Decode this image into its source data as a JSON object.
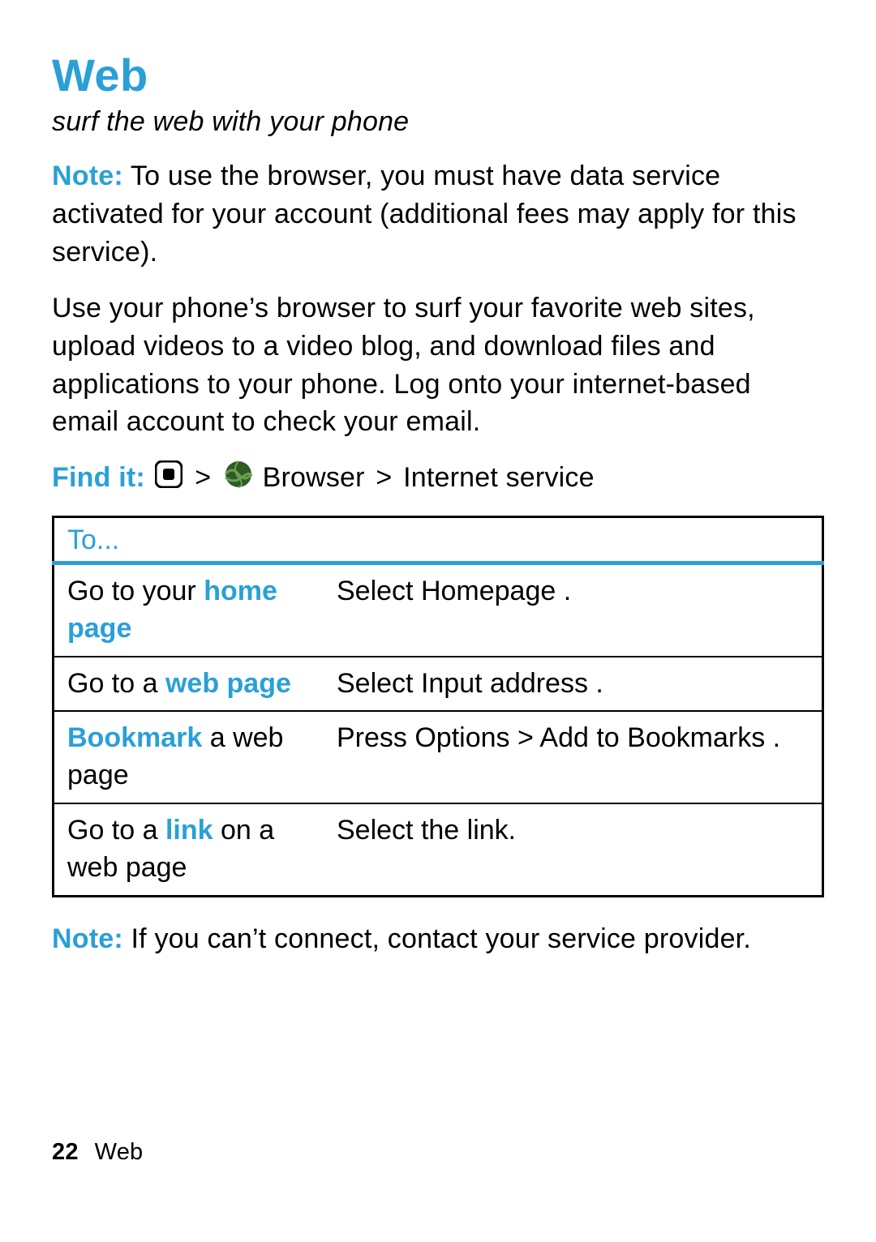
{
  "title": "Web",
  "subtitle": "surf the web with your phone",
  "note1": {
    "label": "Note:",
    "text": " To use the browser, you must have data service activated for your account (additional fees may apply for this service)."
  },
  "para1": "Use your phone’s browser to surf your favorite web sites, upload videos to a video blog, and download files and applications to your phone. Log onto your internet-based email account to check your email.",
  "find_it": {
    "label": "Find it:",
    "sep1": ">",
    "browser": "Browser",
    "sep2": ">",
    "service": "Internet service"
  },
  "table": {
    "header": "To...",
    "rows": [
      {
        "left_pre": "Go to your ",
        "left_accent": "home page",
        "left_post": "",
        "right": "Select Homepage ."
      },
      {
        "left_pre": "Go to a ",
        "left_accent": "web page",
        "left_post": "",
        "right": "Select Input address  ."
      },
      {
        "left_pre": "",
        "left_accent": "Bookmark",
        "left_post": " a web page",
        "right": "Press Options > Add to Bookmarks  ."
      },
      {
        "left_pre": "Go to a ",
        "left_accent": "link",
        "left_post": " on a web page",
        "right": "Select the link."
      }
    ]
  },
  "note2": {
    "label": "Note:",
    "text": " If you can’t connect, contact your service provider."
  },
  "footer": {
    "page": "22",
    "section": "Web"
  }
}
